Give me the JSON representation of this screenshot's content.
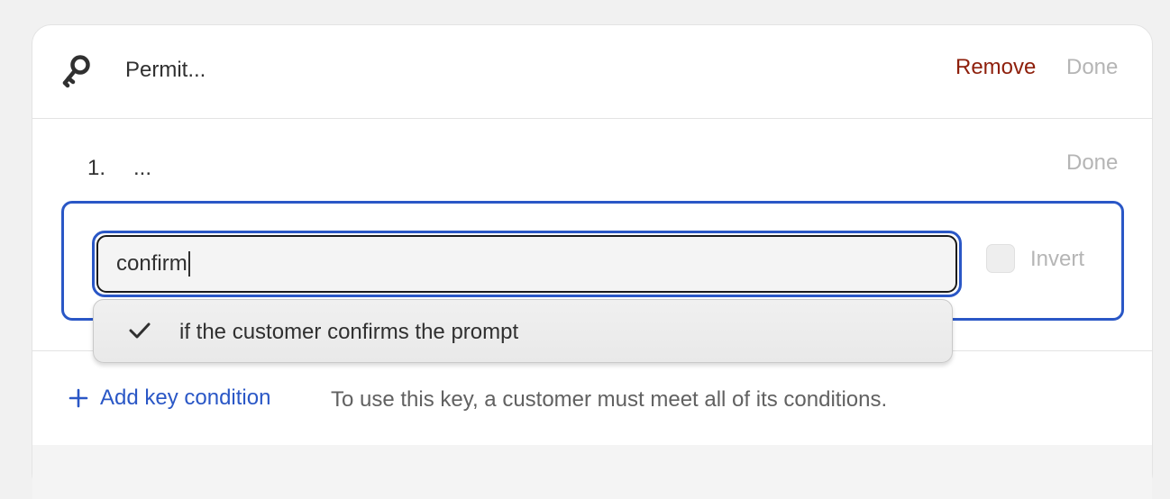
{
  "key": {
    "name": "Permit...",
    "remove_label": "Remove",
    "done_label": "Done"
  },
  "condition": {
    "number": "1.",
    "summary": "...",
    "done_label": "Done",
    "search_value": "confirm",
    "invert_label": "Invert",
    "invert_checked": false,
    "options": [
      {
        "label": "if the customer confirms the prompt",
        "selected": true
      }
    ]
  },
  "footer": {
    "add_label": "Add key condition",
    "hint": "To use this key, a customer must meet all of its conditions."
  },
  "colors": {
    "accent": "#2a57c6",
    "critical": "#8e1f0b",
    "disabled": "#b5b5b5"
  }
}
